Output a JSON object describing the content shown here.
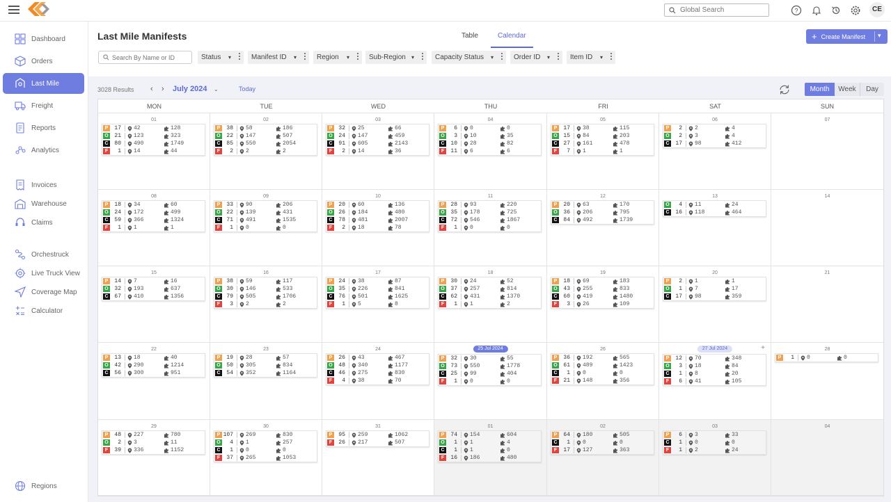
{
  "topbar": {
    "search_placeholder": "Global Search",
    "avatar_initials": "CE",
    "icons": [
      "help-icon",
      "bell-icon",
      "history-icon",
      "settings-icon"
    ]
  },
  "sidebar": {
    "items": [
      {
        "label": "Dashboard",
        "icon": "dashboard-icon"
      },
      {
        "label": "Orders",
        "icon": "box-icon"
      },
      {
        "label": "Last Mile",
        "icon": "last-mile-icon",
        "active": true
      },
      {
        "label": "Freight",
        "icon": "truck-icon"
      },
      {
        "label": "Reports",
        "icon": "reports-icon"
      },
      {
        "label": "Analytics",
        "icon": "analytics-icon"
      },
      {
        "label": "Invoices",
        "icon": "invoice-icon"
      },
      {
        "label": "Warehouse",
        "icon": "warehouse-icon"
      },
      {
        "label": "Claims",
        "icon": "claims-icon"
      },
      {
        "label": "Orchestruck",
        "icon": "route-icon"
      },
      {
        "label": "Live Truck View",
        "icon": "live-icon"
      },
      {
        "label": "Coverage Map",
        "icon": "navigation-icon"
      },
      {
        "label": "Calculator",
        "icon": "calculator-icon"
      }
    ],
    "bottom_item": {
      "label": "Regions",
      "icon": "globe-icon"
    }
  },
  "header": {
    "title": "Last Mile Manifests",
    "tabs": [
      "Table",
      "Calendar"
    ],
    "active_tab": "Calendar",
    "create_label": "Create Manifest"
  },
  "filters": {
    "search_placeholder": "Search By Name or ID",
    "items": [
      "Status",
      "Manifest ID",
      "Region",
      "Sub-Region",
      "Capacity Status",
      "Order ID",
      "Item ID"
    ]
  },
  "calendar": {
    "results": "3028 Results",
    "month": "July 2024",
    "today_label": "Today",
    "views": [
      "Month",
      "Week",
      "Day"
    ],
    "active_view": "Month",
    "days_of_week": [
      "MON",
      "TUE",
      "WED",
      "THU",
      "FRI",
      "SAT",
      "SUN"
    ],
    "colors": {
      "P": "#f0a150",
      "O": "#37a646",
      "C": "#111111",
      "F": "#e0443c",
      "accent": "#6f7ce0"
    },
    "weeks": [
      [
        {
          "date": "01",
          "rows": [
            [
              "P",
              17,
              42,
              128
            ],
            [
              "O",
              21,
              123,
              323
            ],
            [
              "C",
              80,
              490,
              1749
            ],
            [
              "F",
              1,
              14,
              44
            ]
          ]
        },
        {
          "date": "02",
          "rows": [
            [
              "P",
              38,
              58,
              186
            ],
            [
              "O",
              22,
              147,
              507
            ],
            [
              "C",
              85,
              550,
              2054
            ],
            [
              "F",
              2,
              2,
              2
            ]
          ]
        },
        {
          "date": "03",
          "rows": [
            [
              "P",
              32,
              25,
              66
            ],
            [
              "O",
              24,
              147,
              459
            ],
            [
              "C",
              91,
              605,
              2143
            ],
            [
              "F",
              2,
              14,
              36
            ]
          ]
        },
        {
          "date": "04",
          "rows": [
            [
              "P",
              6,
              0,
              0
            ],
            [
              "O",
              3,
              10,
              35
            ],
            [
              "C",
              10,
              28,
              82
            ],
            [
              "F",
              11,
              6,
              6
            ]
          ]
        },
        {
          "date": "05",
          "rows": [
            [
              "P",
              17,
              38,
              115
            ],
            [
              "O",
              15,
              84,
              203
            ],
            [
              "C",
              27,
              161,
              478
            ],
            [
              "F",
              7,
              1,
              1
            ]
          ]
        },
        {
          "date": "06",
          "rows": [
            [
              "P",
              2,
              2,
              4
            ],
            [
              "O",
              2,
              3,
              4
            ],
            [
              "C",
              17,
              98,
              412
            ]
          ]
        },
        {
          "date": "07",
          "rows": []
        }
      ],
      [
        {
          "date": "08",
          "rows": [
            [
              "P",
              18,
              34,
              60
            ],
            [
              "O",
              24,
              172,
              499
            ],
            [
              "C",
              59,
              366,
              1324
            ],
            [
              "F",
              1,
              1,
              1
            ]
          ]
        },
        {
          "date": "09",
          "rows": [
            [
              "P",
              33,
              90,
              206
            ],
            [
              "O",
              22,
              139,
              431
            ],
            [
              "C",
              71,
              491,
              1535
            ],
            [
              "F",
              1,
              0,
              0
            ]
          ]
        },
        {
          "date": "10",
          "rows": [
            [
              "P",
              20,
              60,
              136
            ],
            [
              "O",
              26,
              184,
              480
            ],
            [
              "C",
              78,
              481,
              2007
            ],
            [
              "F",
              2,
              18,
              78
            ]
          ]
        },
        {
          "date": "11",
          "rows": [
            [
              "P",
              28,
              93,
              220
            ],
            [
              "O",
              35,
              178,
              725
            ],
            [
              "C",
              72,
              546,
              1867
            ],
            [
              "F",
              1,
              0,
              0
            ]
          ]
        },
        {
          "date": "12",
          "rows": [
            [
              "P",
              20,
              63,
              170
            ],
            [
              "O",
              36,
              206,
              795
            ],
            [
              "C",
              84,
              492,
              1739
            ]
          ]
        },
        {
          "date": "13",
          "rows": [
            [
              "O",
              4,
              11,
              24
            ],
            [
              "C",
              16,
              118,
              464
            ]
          ]
        },
        {
          "date": "14",
          "rows": []
        }
      ],
      [
        {
          "date": "15",
          "rows": [
            [
              "P",
              14,
              7,
              16
            ],
            [
              "O",
              32,
              193,
              637
            ],
            [
              "C",
              67,
              410,
              1356
            ]
          ]
        },
        {
          "date": "16",
          "rows": [
            [
              "P",
              38,
              59,
              117
            ],
            [
              "O",
              30,
              146,
              533
            ],
            [
              "C",
              79,
              505,
              1706
            ],
            [
              "F",
              3,
              2,
              2
            ]
          ]
        },
        {
          "date": "17",
          "rows": [
            [
              "P",
              24,
              38,
              87
            ],
            [
              "O",
              35,
              226,
              841
            ],
            [
              "C",
              76,
              501,
              1625
            ],
            [
              "F",
              1,
              5,
              8
            ]
          ]
        },
        {
          "date": "18",
          "rows": [
            [
              "P",
              30,
              24,
              52
            ],
            [
              "O",
              37,
              257,
              814
            ],
            [
              "C",
              62,
              431,
              1370
            ],
            [
              "F",
              1,
              1,
              2
            ]
          ]
        },
        {
          "date": "19",
          "rows": [
            [
              "P",
              18,
              69,
              183
            ],
            [
              "O",
              43,
              255,
              833
            ],
            [
              "C",
              60,
              419,
              1480
            ],
            [
              "F",
              3,
              26,
              109
            ]
          ]
        },
        {
          "date": "20",
          "rows": [
            [
              "P",
              2,
              1,
              1
            ],
            [
              "O",
              1,
              7,
              17
            ],
            [
              "C",
              17,
              98,
              359
            ]
          ]
        },
        {
          "date": "21",
          "rows": []
        }
      ],
      [
        {
          "date": "22",
          "rows": [
            [
              "P",
              13,
              18,
              40
            ],
            [
              "O",
              42,
              290,
              1214
            ],
            [
              "C",
              56,
              300,
              951
            ]
          ]
        },
        {
          "date": "23",
          "rows": [
            [
              "P",
              19,
              28,
              57
            ],
            [
              "O",
              50,
              305,
              834
            ],
            [
              "C",
              54,
              352,
              1164
            ]
          ]
        },
        {
          "date": "24",
          "rows": [
            [
              "P",
              26,
              43,
              467
            ],
            [
              "O",
              48,
              340,
              1177
            ],
            [
              "C",
              46,
              275,
              830
            ],
            [
              "F",
              4,
              38,
              70
            ]
          ]
        },
        {
          "date": "25 Jul 2024",
          "badge": "dark",
          "rows": [
            [
              "P",
              32,
              30,
              55
            ],
            [
              "O",
              73,
              550,
              1778
            ],
            [
              "C",
              25,
              99,
              404
            ],
            [
              "F",
              1,
              0,
              0
            ]
          ]
        },
        {
          "date": "26",
          "rows": [
            [
              "P",
              36,
              192,
              565
            ],
            [
              "O",
              61,
              489,
              1423
            ],
            [
              "C",
              1,
              0,
              0
            ],
            [
              "F",
              21,
              148,
              356
            ]
          ]
        },
        {
          "date": "27 Jul 2024",
          "badge": "light",
          "plus": "+",
          "rows": [
            [
              "P",
              12,
              70,
              348
            ],
            [
              "O",
              3,
              18,
              84
            ],
            [
              "C",
              1,
              8,
              20
            ],
            [
              "F",
              6,
              41,
              105
            ]
          ]
        },
        {
          "date": "28",
          "rows": [
            [
              "P",
              1,
              0,
              0
            ]
          ]
        }
      ],
      [
        {
          "date": "29",
          "rows": [
            [
              "P",
              48,
              227,
              780
            ],
            [
              "O",
              2,
              3,
              11
            ],
            [
              "F",
              39,
              336,
              1152
            ]
          ]
        },
        {
          "date": "30",
          "rows": [
            [
              "P",
              107,
              269,
              830
            ],
            [
              "O",
              4,
              1,
              257
            ],
            [
              "C",
              1,
              0,
              0
            ],
            [
              "F",
              37,
              265,
              1053
            ]
          ]
        },
        {
          "date": "31",
          "rows": [
            [
              "P",
              95,
              259,
              1062
            ],
            [
              "F",
              26,
              217,
              507
            ]
          ]
        },
        {
          "date": "01",
          "gray": true,
          "rows": [
            [
              "P",
              74,
              154,
              604
            ],
            [
              "O",
              1,
              1,
              4
            ],
            [
              "C",
              1,
              1,
              0
            ],
            [
              "F",
              16,
              186,
              480
            ]
          ]
        },
        {
          "date": "02",
          "gray": true,
          "rows": [
            [
              "P",
              64,
              180,
              505
            ],
            [
              "C",
              1,
              0,
              0
            ],
            [
              "F",
              17,
              127,
              363
            ]
          ]
        },
        {
          "date": "03",
          "gray": true,
          "rows": [
            [
              "P",
              6,
              3,
              33
            ],
            [
              "C",
              1,
              0,
              0
            ],
            [
              "F",
              1,
              2,
              24
            ]
          ]
        },
        {
          "date": "04",
          "gray": true,
          "rows": []
        }
      ]
    ]
  }
}
